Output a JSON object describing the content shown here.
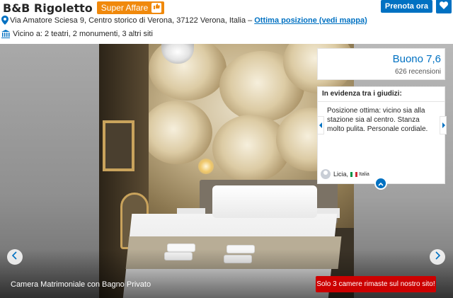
{
  "header": {
    "hotel_name": "B&B Rigoletto",
    "badge_label": "Super Affare",
    "address": "Via Amatore Sciesa 9, Centro storico di Verona, 37122 Verona, Italia –",
    "map_link": "Ottima posizione (vedi mappa)",
    "nearby": "Vicino a: 2 teatri, 2 monumenti, 3 altri siti",
    "book_button": "Prenota ora",
    "brand_color": "#0071c2",
    "badge_color": "#f0890c"
  },
  "gallery": {
    "caption": "Camera Matrimoniale con Bagno Privato",
    "availability_notice": "Solo 3 camere rimaste sul nostro sito!",
    "notice_color": "#cc0000"
  },
  "reviews": {
    "score_label": "Buono 7,6",
    "review_count": "626 recensioni",
    "highlight_heading": "In evidenza tra i giudizi:",
    "highlight_text": "Posizione ottima: vicino sia alla stazione sia al centro. Stanza molto pulita. Personale cordiale.",
    "reviewer_name": "Licia,",
    "reviewer_country": "Italia"
  },
  "icons": [
    "pin-icon",
    "museum-icon",
    "heart-icon",
    "thumbs-up-icon",
    "chevron-left-icon",
    "chevron-right-icon",
    "chevron-up-icon",
    "avatar-icon",
    "italy-flag-icon"
  ]
}
